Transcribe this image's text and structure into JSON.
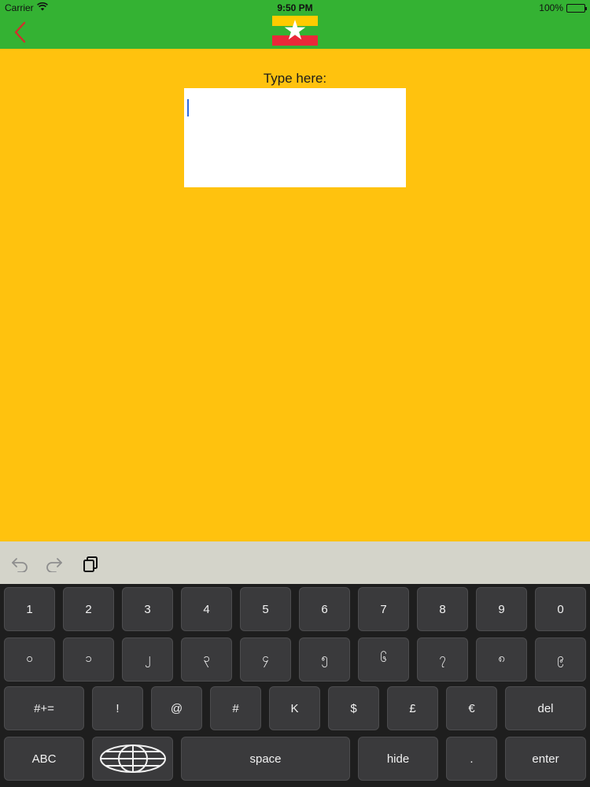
{
  "status": {
    "carrier": "Carrier",
    "time": "9:50 PM",
    "battery": "100%"
  },
  "nav": {
    "back_icon": "chevron-left-icon",
    "flag_icon": "myanmar-flag-icon",
    "colors": {
      "bar": "#34B233",
      "back": "#D0302C",
      "flag_yellow": "#FECB00",
      "flag_green": "#34B233",
      "flag_red": "#EA2839"
    }
  },
  "main": {
    "prompt": "Type here:",
    "text_value": "",
    "background": "#FFC20E"
  },
  "toolbar": {
    "undo_icon": "undo-icon",
    "redo_icon": "redo-icon",
    "copy_icon": "copy-icon"
  },
  "keyboard": {
    "row1": [
      "1",
      "2",
      "3",
      "4",
      "5",
      "6",
      "7",
      "8",
      "9",
      "0"
    ],
    "row2": [
      "၀",
      "၁",
      "၂",
      "၃",
      "၄",
      "၅",
      "၆",
      "၇",
      "၈",
      "၉"
    ],
    "row3": [
      "#+=",
      "!",
      "@",
      "#",
      "K",
      "$",
      "£",
      "€",
      "del"
    ],
    "row4": {
      "abc": "ABC",
      "globe_icon": "globe-icon",
      "space": "space",
      "hide": "hide",
      "period": ".",
      "enter": "enter"
    }
  }
}
